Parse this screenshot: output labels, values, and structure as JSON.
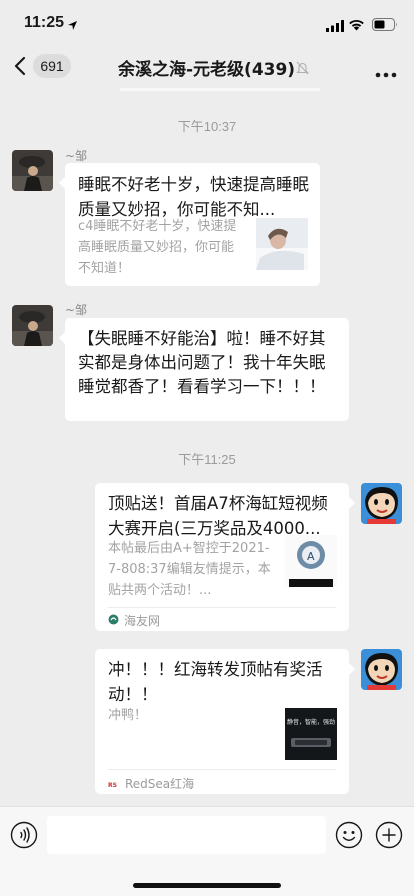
{
  "status_bar": {
    "time": "11:25"
  },
  "nav": {
    "badge": "691",
    "title": "余溪之海-元老级(439)"
  },
  "messages": [
    {
      "time": "下午10:37"
    },
    {
      "sender": "~邹",
      "card": {
        "title": "睡眠不好老十岁，快速提高睡眠质量又妙招，你可能不知...",
        "desc": "c4睡眠不好老十岁，快速提高睡眠质量又妙招，你可能不知道！"
      }
    },
    {
      "sender": "~邹",
      "text": "【失眠睡不好能治】啦！睡不好其实都是身体出问题了！我十年失眠睡觉都香了！看看学习一下！！！"
    },
    {
      "time": "下午11:25"
    },
    {
      "card": {
        "title": "顶贴送！首届A7杯海缸短视频大赛开启(三万奖品及4000...",
        "desc": "本帖最后由A+智控于2021-7-808:37编辑友情提示，本贴共两个活动！...",
        "source": "海友网"
      }
    },
    {
      "card": {
        "title": "冲！！！红海转发顶帖有奖活动！！",
        "desc": "冲鸭！",
        "source": "RedSea红海",
        "thumb_text": "静音，智能，强劲"
      }
    }
  ]
}
